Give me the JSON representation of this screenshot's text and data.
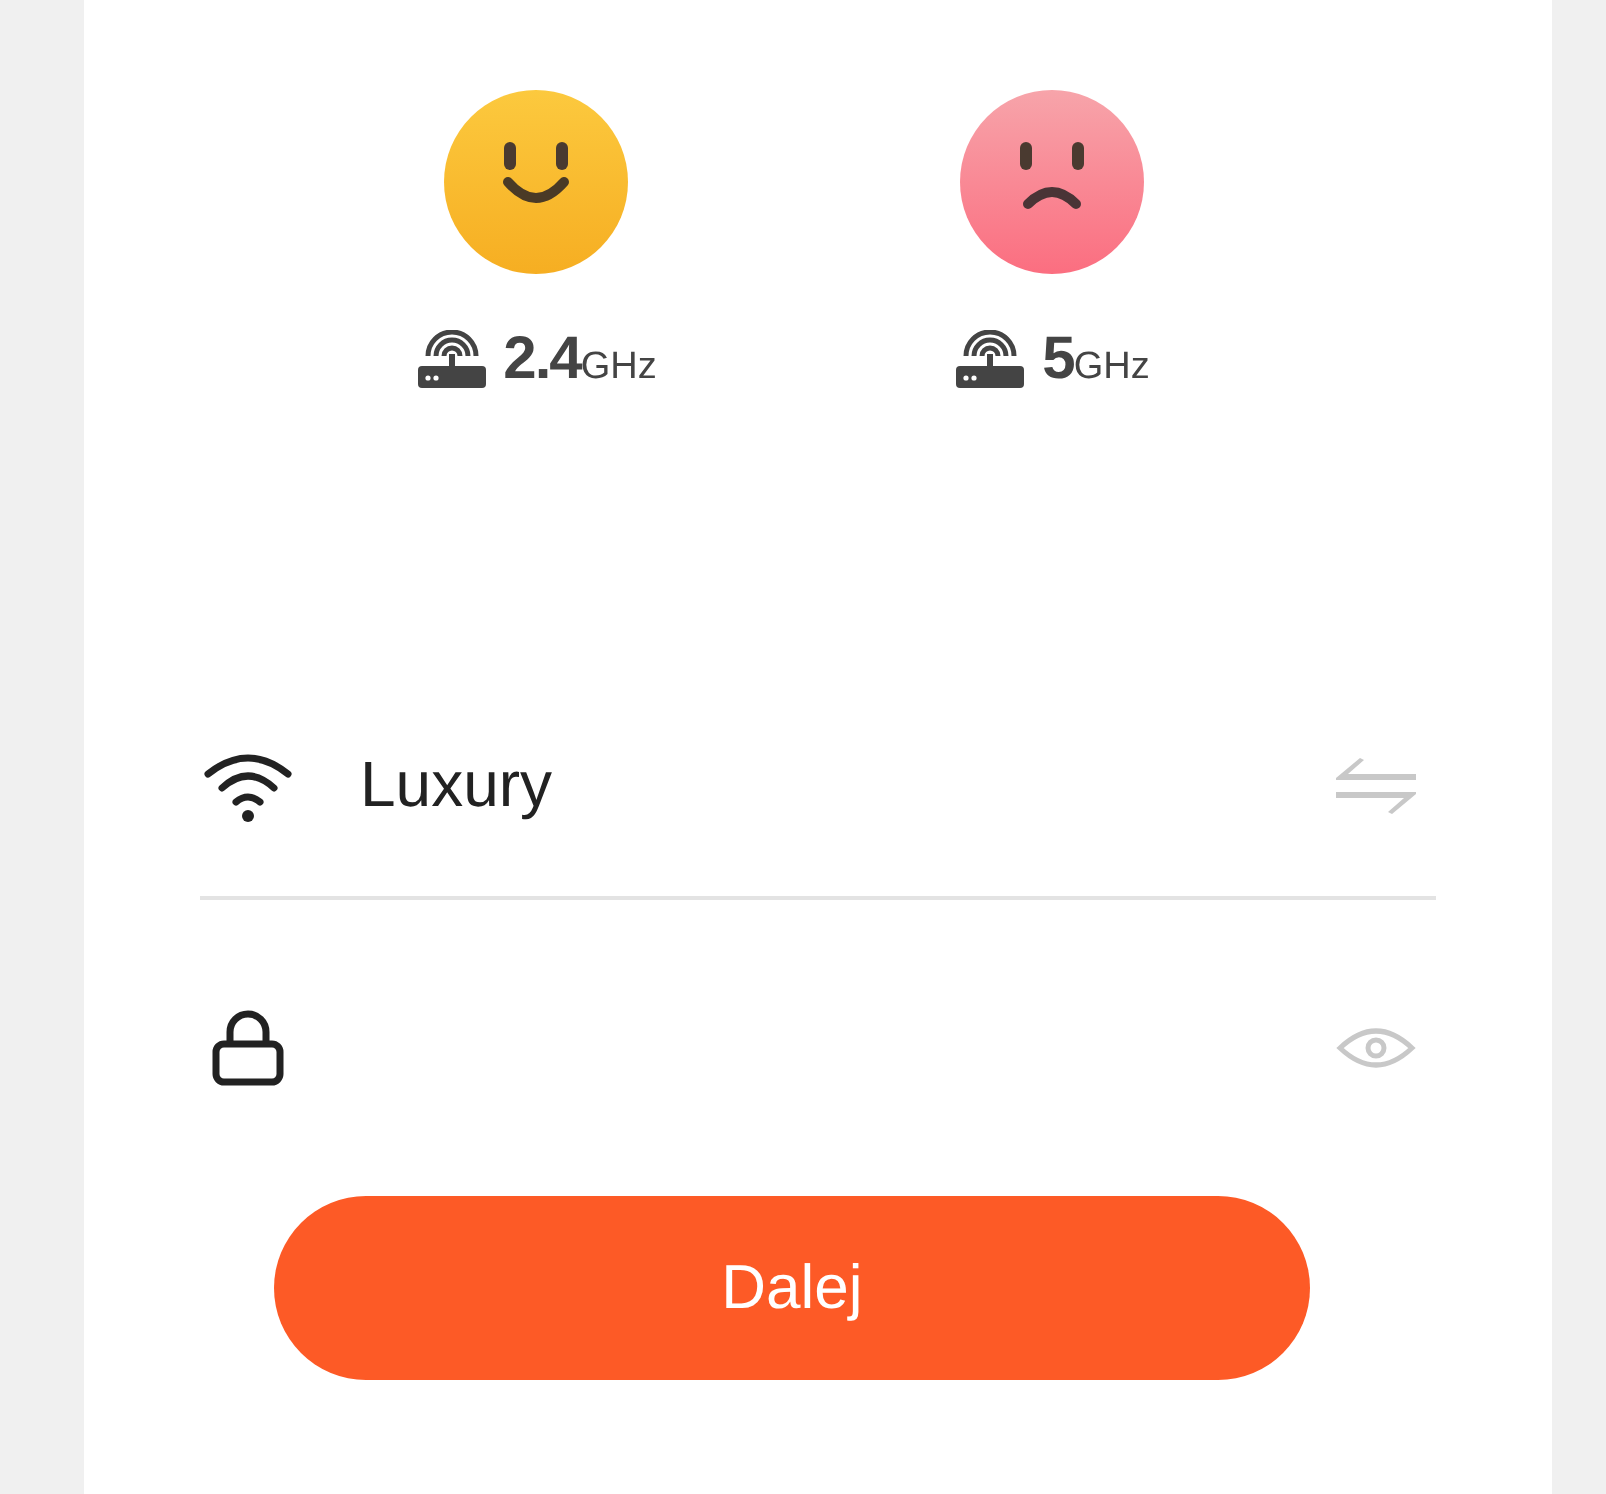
{
  "bands": [
    {
      "kind": "happy",
      "value": "2.4",
      "unit": "GHz"
    },
    {
      "kind": "sad",
      "value": "5",
      "unit": "GHz"
    }
  ],
  "network": {
    "value": "Luxury"
  },
  "next_button": {
    "label": "Dalej"
  }
}
